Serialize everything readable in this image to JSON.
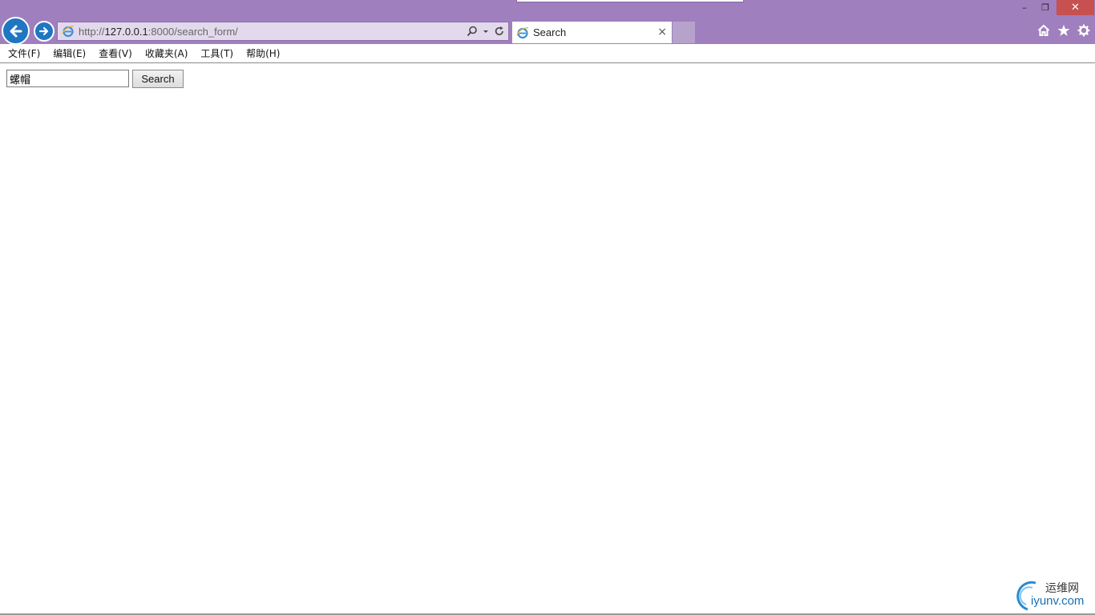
{
  "browser": {
    "url": {
      "prefix": "http://",
      "host": "127.0.0.1",
      "rest": ":8000/search_form/"
    },
    "tab_title": "Search",
    "tab_close": "×",
    "window_controls": {
      "minimize": "–",
      "restore": "❐",
      "close": "✕"
    }
  },
  "menu": {
    "items": [
      "文件(F)",
      "编辑(E)",
      "查看(V)",
      "收藏夹(A)",
      "工具(T)",
      "帮助(H)"
    ]
  },
  "form": {
    "query_value": "螺帽",
    "button_label": "Search"
  },
  "watermark": {
    "cn": "运维网",
    "en": "iyunv.com"
  },
  "colors": {
    "chrome": "#9f7fbd",
    "nav_blue": "#1f76c2",
    "close_red": "#c75050"
  },
  "icons": [
    "back-arrow-icon",
    "forward-arrow-icon",
    "ie-logo-icon",
    "search-icon",
    "dropdown-icon",
    "refresh-icon",
    "home-icon",
    "star-icon",
    "gear-icon"
  ]
}
